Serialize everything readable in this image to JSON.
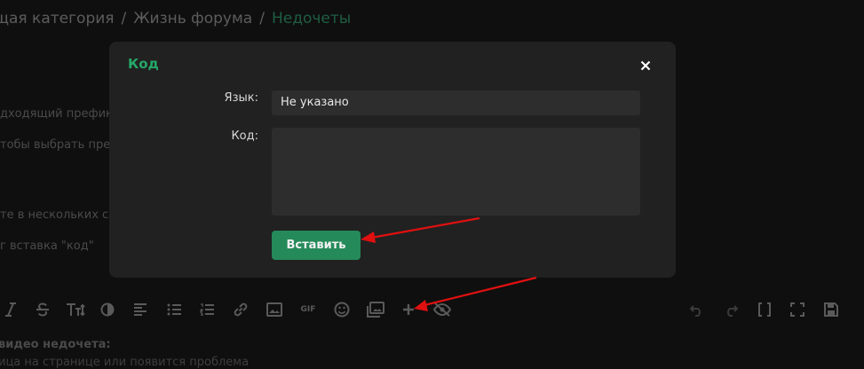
{
  "breadcrumb": {
    "items": [
      "щая категория",
      "Жизнь форума"
    ],
    "current": "Недочеты",
    "separator": "/"
  },
  "background": {
    "line1": "дходящий префикс",
    "line2": "тобы выбрать преф",
    "line3": "те в нескольких сло",
    "line4": "г вставка \"код\"",
    "bottom1": "видео недочета:",
    "bottom2": "ица на странице или появится проблема"
  },
  "modal": {
    "title": "Код",
    "language_label": "Язык:",
    "language_value": "Не указано",
    "code_label": "Код:",
    "code_value": "",
    "insert_label": "Вставить"
  },
  "toolbar": {
    "gif_label": "GIF",
    "icons": [
      "italic-icon",
      "strikethrough-icon",
      "text-size-icon",
      "color-icon",
      "align-icon",
      "bullet-list-icon",
      "numbered-list-icon",
      "link-icon",
      "image-icon",
      "gif-icon",
      "emoji-icon",
      "media-icon",
      "insert-plus-icon",
      "hide-icon",
      "undo-icon",
      "redo-icon",
      "bbcode-icon",
      "fullscreen-icon",
      "save-draft-icon"
    ]
  },
  "colors": {
    "accent": "#25a868",
    "button": "#258a5a",
    "arrow": "#e01010"
  }
}
